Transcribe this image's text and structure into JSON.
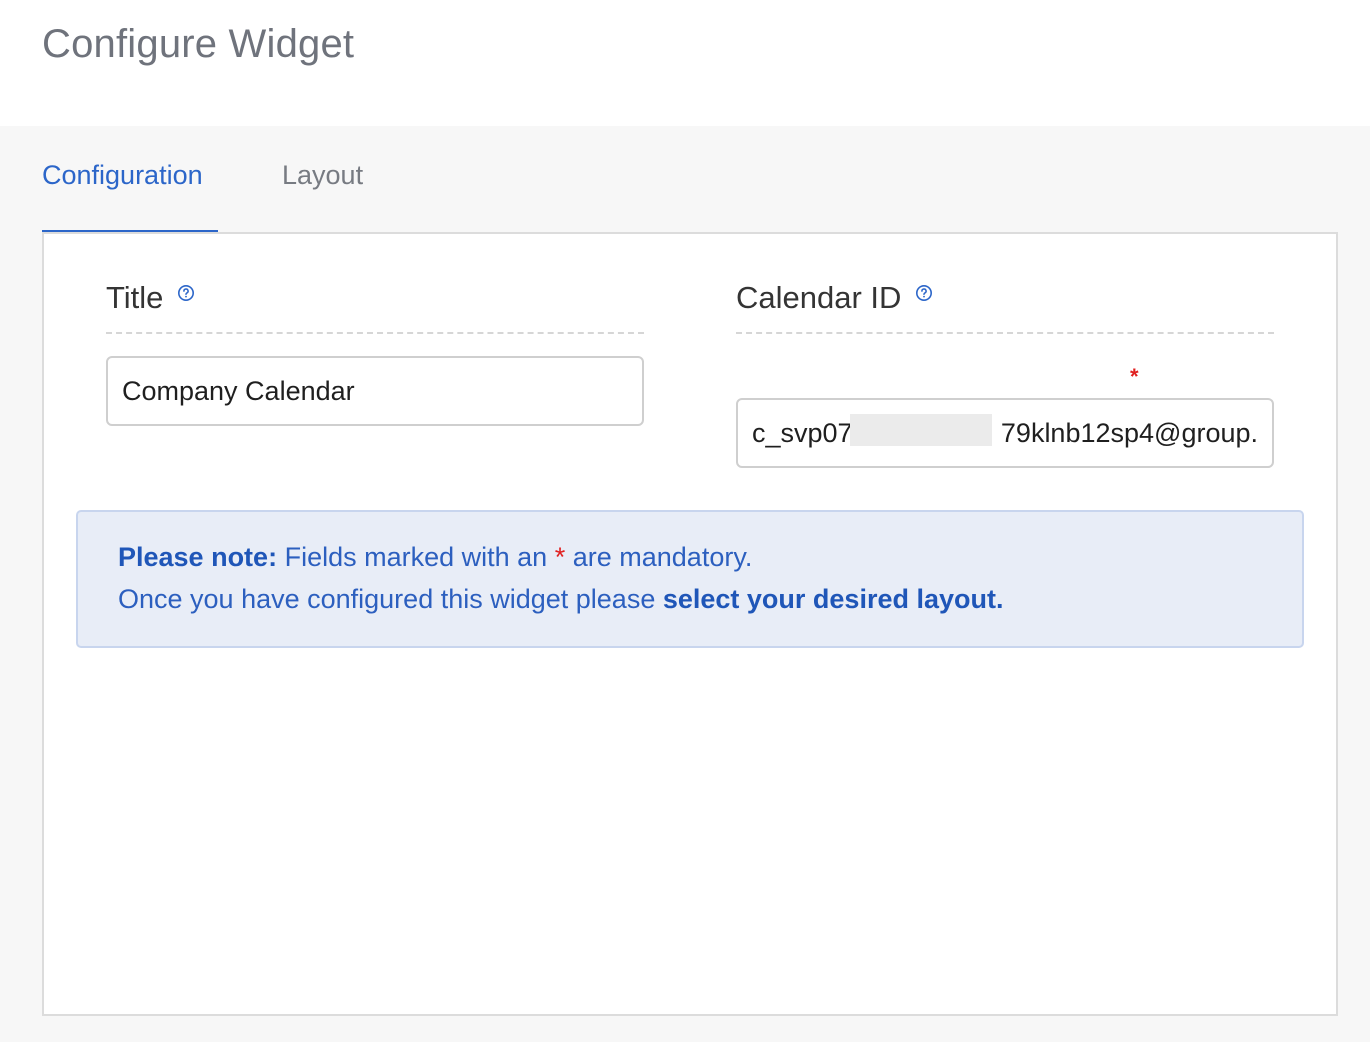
{
  "header": {
    "title": "Configure Widget"
  },
  "tabs": [
    {
      "label": "Configuration",
      "active": true
    },
    {
      "label": "Layout",
      "active": false
    }
  ],
  "form": {
    "title_field": {
      "label": "Title",
      "value": "Company Calendar",
      "help_icon": "question-circle-icon"
    },
    "calendar_field": {
      "label": "Calendar ID",
      "value_start": "c_svp07",
      "value_end": "79klnb12sp4@group.",
      "required_marker": "*",
      "help_icon": "question-circle-icon"
    }
  },
  "note": {
    "line1_bold": "Please note:",
    "line1_text_a": "Fields marked with an",
    "line1_star": "*",
    "line1_text_b": "are mandatory.",
    "line2_text": "Once you have configured this widget please",
    "line2_bold": "select your desired layout."
  },
  "colors": {
    "accent": "#2c66c9",
    "required": "#e02020",
    "note_bg": "#e8edf7"
  }
}
